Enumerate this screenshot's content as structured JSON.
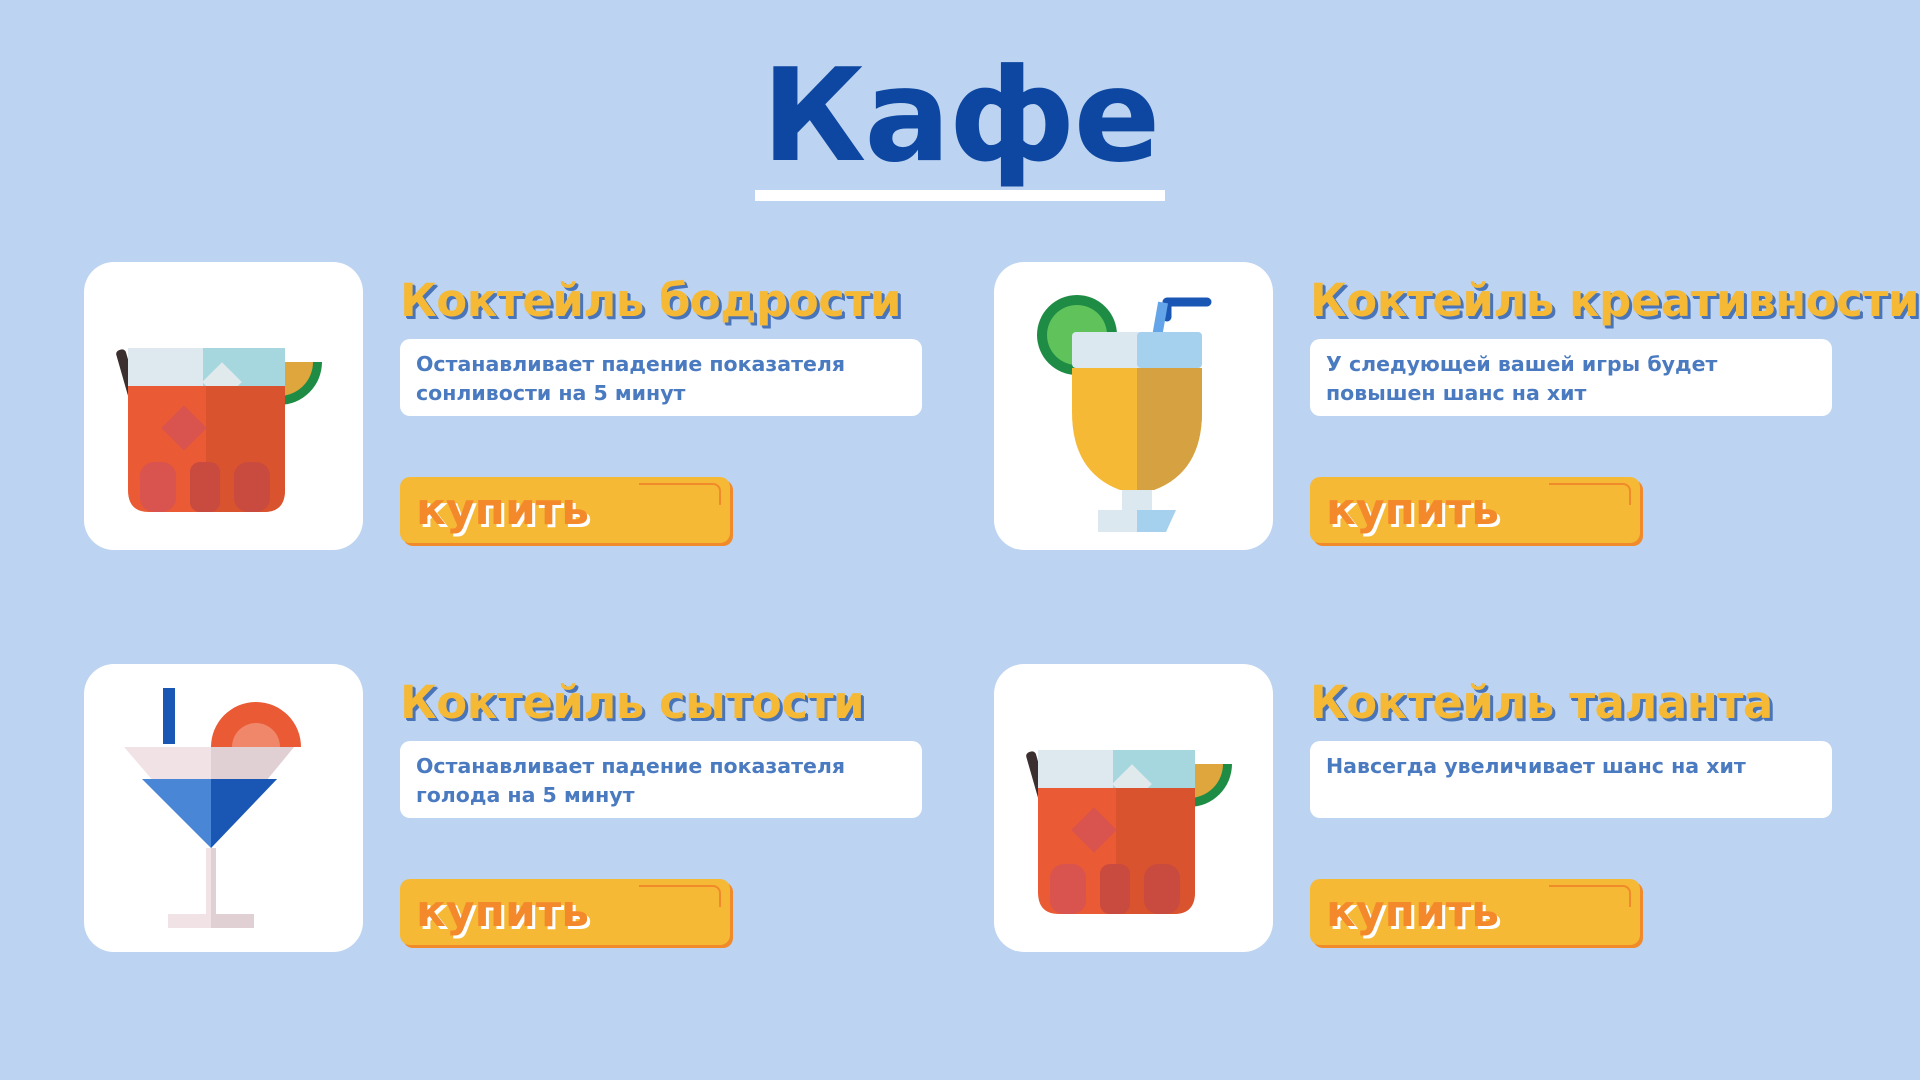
{
  "page": {
    "title": "Кафе"
  },
  "items": [
    {
      "name": "Коктейль бодрости",
      "description": "Останавливает падение показателя сонливости на 5 минут",
      "buy_label": "купить",
      "icon": "red-cocktail-glass-with-lemon-icon"
    },
    {
      "name": "Коктейль креативности",
      "description": "У следующей вашей игры будет повышен шанс на хит",
      "buy_label": "купить",
      "icon": "yellow-cocktail-with-lime-icon"
    },
    {
      "name": "Коктейль сытости",
      "description": "Останавливает падение показателя голода на 5 минут",
      "buy_label": "купить",
      "icon": "martini-glass-with-orange-icon"
    },
    {
      "name": "Коктейль таланта",
      "description": "Навсегда увеличивает шанс на хит",
      "buy_label": "купить",
      "icon": "red-cocktail-glass-with-lemon-icon"
    }
  ],
  "colors": {
    "background": "#bcd3f1",
    "title": "#0d47a1",
    "item_name": "#f5b935",
    "button": "#f5b935",
    "button_text": "#f4892c",
    "description_text": "#4a7ac0"
  }
}
